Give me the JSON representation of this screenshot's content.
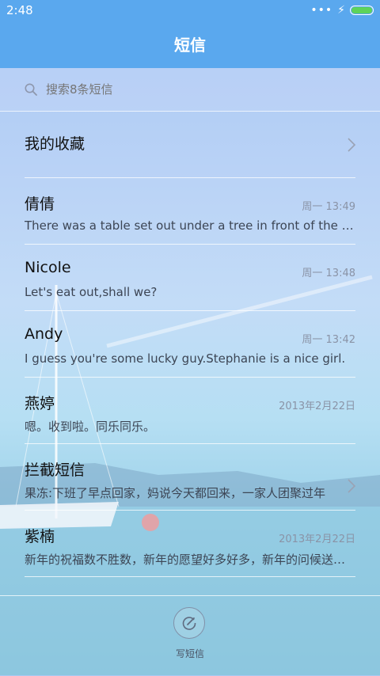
{
  "status": {
    "time": "2:48",
    "signal_dots": "•••",
    "charging": "⚡"
  },
  "header": {
    "title": "短信"
  },
  "search": {
    "placeholder": "搜索8条短信"
  },
  "favorites": {
    "label": "我的收藏"
  },
  "messages": [
    {
      "name": "倩倩",
      "date": "周一 13:49",
      "preview": "There was a table set out under a tree in front of the house"
    },
    {
      "name": "Nicole",
      "date": "周一 13:48",
      "preview": "Let's eat out,shall we?"
    },
    {
      "name": "Andy",
      "date": "周一 13:42",
      "preview": "I guess you're some lucky guy.Stephanie is a nice girl."
    },
    {
      "name": "燕婷",
      "date": "2013年2月22日",
      "preview": "嗯。收到啦。同乐同乐。"
    },
    {
      "name": "拦截短信",
      "date": "",
      "preview": "果冻:下班了早点回家，妈说今天都回来，一家人团聚过年"
    },
    {
      "name": "紫楠",
      "date": "2013年2月22日",
      "preview": "新年的祝福数不胜数，新年的愿望好多好多，新年的问候送给你"
    }
  ],
  "compose": {
    "label": "写短信"
  },
  "icons": {
    "search": "search-icon",
    "chevron": "chevron-right-icon",
    "compose": "compose-icon",
    "battery": "battery-icon"
  },
  "colors": {
    "accent": "#5aa8ee",
    "battery": "#5ed35a"
  }
}
